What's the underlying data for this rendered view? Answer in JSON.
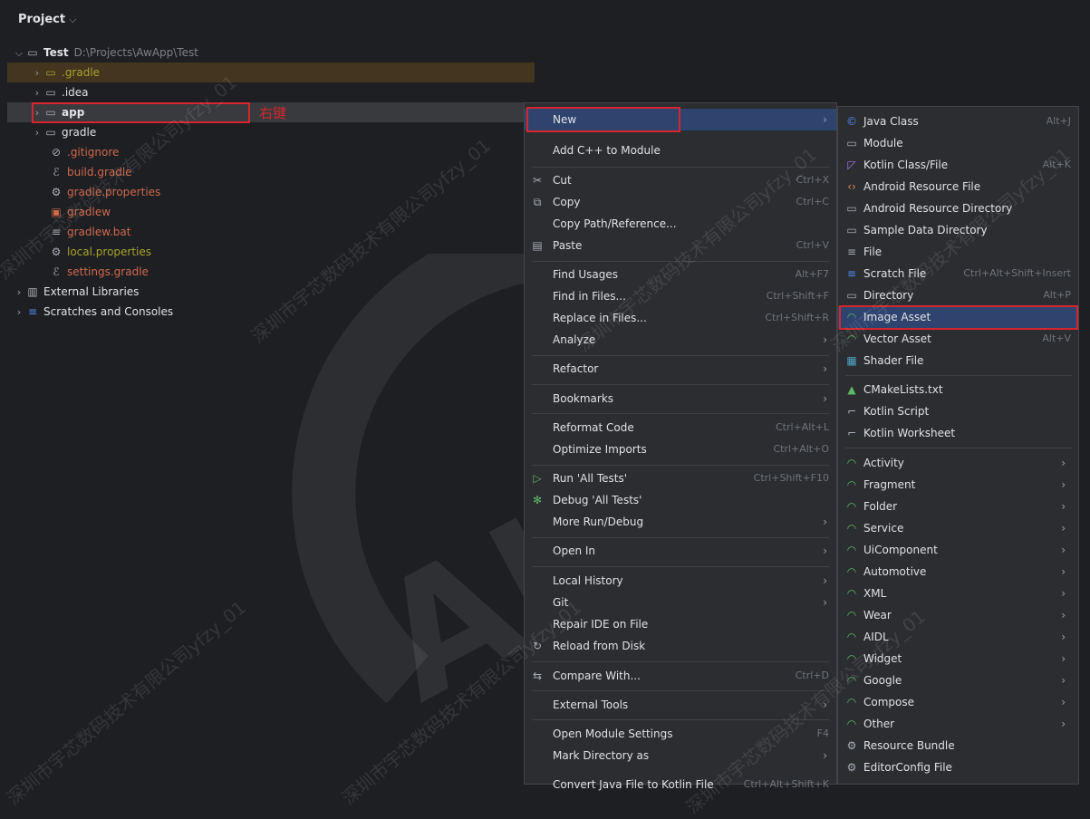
{
  "panel": {
    "title": "Project",
    "title_chevron": "⌵"
  },
  "tree": {
    "root_name": "Test",
    "root_path": "D:\\Projects\\AwApp\\Test",
    "items": [
      {
        "label": ".gradle"
      },
      {
        "label": ".idea"
      },
      {
        "label": "app"
      },
      {
        "label": "gradle"
      },
      {
        "label": ".gitignore"
      },
      {
        "label": "build.gradle"
      },
      {
        "label": "gradle.properties"
      },
      {
        "label": "gradlew"
      },
      {
        "label": "gradlew.bat"
      },
      {
        "label": "local.properties"
      },
      {
        "label": "settings.gradle"
      },
      {
        "label": "External Libraries"
      },
      {
        "label": "Scratches and Consoles"
      }
    ],
    "annotation": "右键"
  },
  "menu": {
    "items": [
      {
        "label": "New"
      },
      {
        "label": "Add C++ to Module"
      },
      {
        "label": "Cut",
        "shortcut": "Ctrl+X"
      },
      {
        "label": "Copy",
        "shortcut": "Ctrl+C"
      },
      {
        "label": "Copy Path/Reference..."
      },
      {
        "label": "Paste",
        "shortcut": "Ctrl+V"
      },
      {
        "label": "Find Usages",
        "shortcut": "Alt+F7"
      },
      {
        "label": "Find in Files...",
        "shortcut": "Ctrl+Shift+F"
      },
      {
        "label": "Replace in Files...",
        "shortcut": "Ctrl+Shift+R"
      },
      {
        "label": "Analyze"
      },
      {
        "label": "Refactor"
      },
      {
        "label": "Bookmarks"
      },
      {
        "label": "Reformat Code",
        "shortcut": "Ctrl+Alt+L"
      },
      {
        "label": "Optimize Imports",
        "shortcut": "Ctrl+Alt+O"
      },
      {
        "label": "Run 'All Tests'",
        "shortcut": "Ctrl+Shift+F10"
      },
      {
        "label": "Debug 'All Tests'"
      },
      {
        "label": "More Run/Debug"
      },
      {
        "label": "Open In"
      },
      {
        "label": "Local History"
      },
      {
        "label": "Git"
      },
      {
        "label": "Repair IDE on File"
      },
      {
        "label": "Reload from Disk"
      },
      {
        "label": "Compare With...",
        "shortcut": "Ctrl+D"
      },
      {
        "label": "External Tools"
      },
      {
        "label": "Open Module Settings",
        "shortcut": "F4"
      },
      {
        "label": "Mark Directory as"
      },
      {
        "label": "Convert Java File to Kotlin File",
        "shortcut": "Ctrl+Alt+Shift+K"
      }
    ]
  },
  "submenu": {
    "items": [
      {
        "label": "Java Class",
        "shortcut": "Alt+J"
      },
      {
        "label": "Module"
      },
      {
        "label": "Kotlin Class/File",
        "shortcut": "Alt+K"
      },
      {
        "label": "Android Resource File"
      },
      {
        "label": "Android Resource Directory"
      },
      {
        "label": "Sample Data Directory"
      },
      {
        "label": "File"
      },
      {
        "label": "Scratch File",
        "shortcut": "Ctrl+Alt+Shift+Insert"
      },
      {
        "label": "Directory",
        "shortcut": "Alt+P"
      },
      {
        "label": "Image Asset"
      },
      {
        "label": "Vector Asset",
        "shortcut": "Alt+V"
      },
      {
        "label": "Shader File"
      },
      {
        "label": "CMakeLists.txt"
      },
      {
        "label": "Kotlin Script"
      },
      {
        "label": "Kotlin Worksheet"
      },
      {
        "label": "Activity"
      },
      {
        "label": "Fragment"
      },
      {
        "label": "Folder"
      },
      {
        "label": "Service"
      },
      {
        "label": "UiComponent"
      },
      {
        "label": "Automotive"
      },
      {
        "label": "XML"
      },
      {
        "label": "Wear"
      },
      {
        "label": "AIDL"
      },
      {
        "label": "Widget"
      },
      {
        "label": "Google"
      },
      {
        "label": "Compose"
      },
      {
        "label": "Other"
      },
      {
        "label": "Resource Bundle"
      },
      {
        "label": "EditorConfig File"
      }
    ]
  },
  "watermark": {
    "text": "深圳市宇芯数码技术有限公司yfzy_01",
    "logo": "ALLWINER"
  }
}
